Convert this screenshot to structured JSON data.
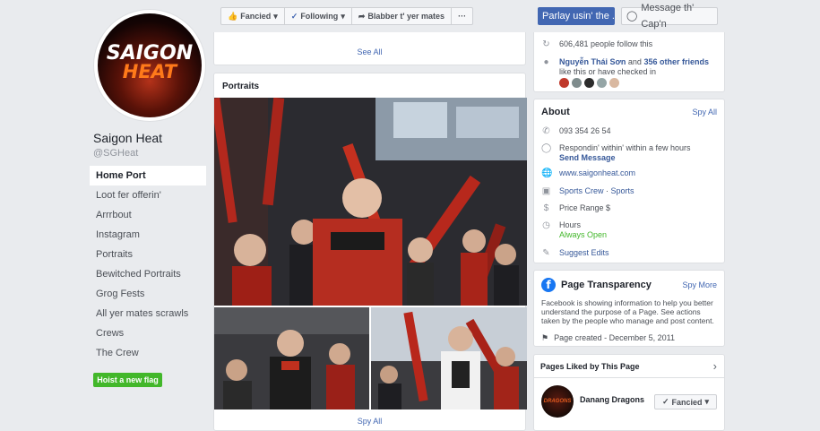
{
  "profile": {
    "logo_line1": "SAIGON",
    "logo_line2": "HEAT",
    "name": "Saigon Heat",
    "handle": "@SGHeat"
  },
  "nav": {
    "items": [
      {
        "label": "Home Port"
      },
      {
        "label": "Loot fer offerin'"
      },
      {
        "label": "Arrrbout"
      },
      {
        "label": "Instagram"
      },
      {
        "label": "Portraits"
      },
      {
        "label": "Bewitched Portraits"
      },
      {
        "label": "Grog Fests"
      },
      {
        "label": "All yer mates scrawls"
      },
      {
        "label": "Crews"
      },
      {
        "label": "The Crew"
      }
    ],
    "create_flag_label": "Hoist a new flag"
  },
  "toolbar": {
    "fancied": "Fancied",
    "following": "Following",
    "share": "Blabber t' yer mates",
    "more": "···",
    "parlay": "Parlay usin' the ...",
    "message": "Message th' Cap'n"
  },
  "main": {
    "see_all_top": "See All",
    "portraits_title": "Portraits",
    "spy_all_bottom": "Spy All"
  },
  "community": {
    "followers": "606,481 people follow this",
    "friend_name": "Nguyễn Thái Sơn",
    "friend_mid": "and",
    "friends_count": "356 other friends",
    "friends_tail": "like this or have checked in"
  },
  "about": {
    "title": "About",
    "spy_all": "Spy All",
    "phone": "093 354 26 54",
    "response": "Respondin' within' within a few hours",
    "send_message": "Send Message",
    "website": "www.saigonheat.com",
    "category1": "Sports Crew",
    "category_sep": "·",
    "category2": "Sports",
    "price": "Price Range $",
    "hours": "Hours",
    "hours_status": "Always Open",
    "suggest": "Suggest Edits"
  },
  "transparency": {
    "title": "Page Transparency",
    "spy_more": "Spy More",
    "text": "Facebook is showing information to help you better understand the purpose of a Page. See actions taken by the people who manage and post content.",
    "created": "Page created - December 5, 2011"
  },
  "liked": {
    "title": "Pages Liked by This Page",
    "page_name": "Danang Dragons",
    "page_logo_text": "DRAGONS",
    "button": "Fancied"
  },
  "colors": {
    "brand_blue": "#4267b2",
    "link_blue": "#365899",
    "green": "#42b72a",
    "background": "#e9ebee"
  }
}
